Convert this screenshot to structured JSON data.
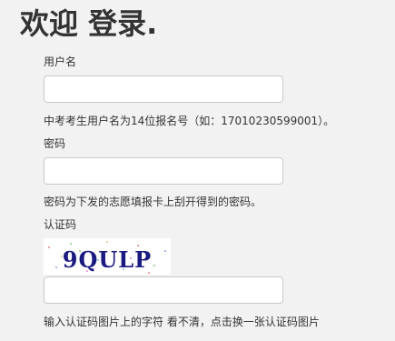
{
  "page": {
    "title": "欢迎 登录."
  },
  "form": {
    "username": {
      "label": "用户名",
      "value": "",
      "help": "中考考生用户名为14位报名号（如：17010230599001）。"
    },
    "password": {
      "label": "密码",
      "value": "",
      "help": "密码为下发的志愿填报卡上刮开得到的密码。"
    },
    "captcha": {
      "label": "认证码",
      "image_text": "9QULP",
      "value": "",
      "help": "输入认证码图片上的字符 看不清，点击换一张认证码图片"
    }
  },
  "colors": {
    "captcha_purple": "#7b1f7b",
    "captcha_green": "#2e8b2e",
    "captcha_orange": "#e69b1e",
    "captcha_navy": "#1a1a80"
  }
}
